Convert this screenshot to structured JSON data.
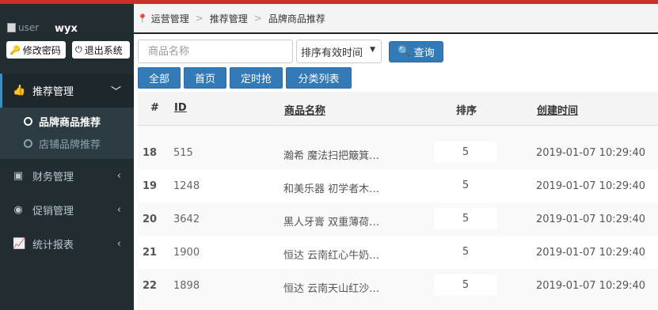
{
  "sidebar": {
    "avatar_alt": "user",
    "user_name": "wyx",
    "change_password": "修改密码",
    "logout": "退出系统",
    "menu": [
      {
        "label": "推荐管理",
        "icon": "thumbs-up-icon",
        "arrow": "﹀"
      },
      {
        "label": "财务管理",
        "icon": "money-icon",
        "arrow": "‹"
      },
      {
        "label": "促销管理",
        "icon": "bullseye-icon",
        "arrow": "‹"
      },
      {
        "label": "统计报表",
        "icon": "line-chart-icon",
        "arrow": "‹"
      }
    ],
    "submenu": [
      {
        "label": "品牌商品推荐"
      },
      {
        "label": "店铺品牌推荐"
      }
    ]
  },
  "breadcrumb": [
    "运营管理",
    "推荐管理",
    "品牌商品推荐"
  ],
  "toolbar": {
    "search_placeholder": "商品名称",
    "sort_select": "排序有效时间",
    "query_label": "查询",
    "tabs": [
      "全部",
      "首页",
      "定时抢",
      "分类列表"
    ]
  },
  "table": {
    "headers": {
      "index": "#",
      "id": "ID",
      "name": "商品名称",
      "sort": "排序",
      "created": "创建时间"
    },
    "rows": [
      {
        "index": "18",
        "id": "515",
        "name": "瀚希 魔法扫把簸箕…",
        "sort": "5",
        "created": "2019-01-07 10:29:40"
      },
      {
        "index": "19",
        "id": "1248",
        "name": "和美乐器 初学者木…",
        "sort": "5",
        "created": "2019-01-07 10:29:40"
      },
      {
        "index": "20",
        "id": "3642",
        "name": "黑人牙膏 双重薄荷…",
        "sort": "5",
        "created": "2019-01-07 10:29:40"
      },
      {
        "index": "21",
        "id": "1900",
        "name": "恒达 云南红心牛奶…",
        "sort": "5",
        "created": "2019-01-07 10:29:40"
      },
      {
        "index": "22",
        "id": "1898",
        "name": "恒达 云南天山红沙…",
        "sort": "5",
        "created": "2019-01-07 10:29:40"
      }
    ]
  },
  "colors": {
    "accent": "#337ab7",
    "sidebar_bg": "#222d32",
    "top_strip": "#c9302c"
  }
}
